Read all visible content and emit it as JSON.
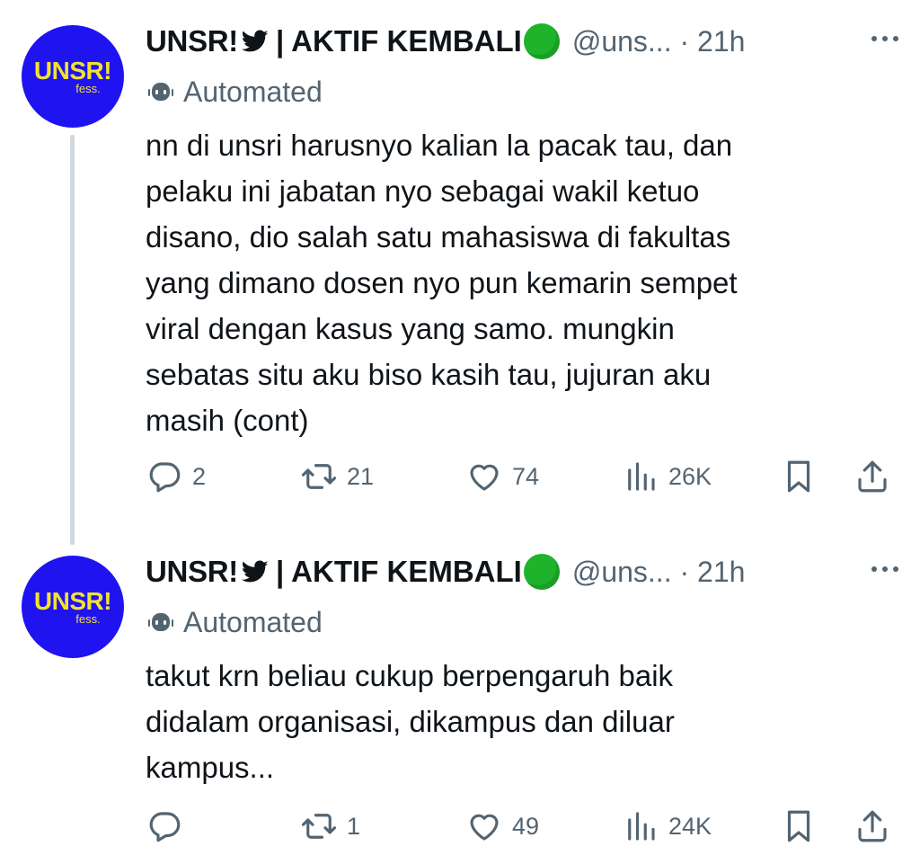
{
  "tweets": [
    {
      "avatar": {
        "main": "UNSR!",
        "sub": "fess."
      },
      "name": "UNSR!",
      "name_rest": "| AKTIF KEMBALI",
      "handle": "@uns... · 21h",
      "label": "Automated",
      "text_lines": [
        "nn di unsri harusnyo kalian la pacak tau, dan",
        "pelaku ini jabatan nyo sebagai wakil ketuo",
        "disano, dio salah satu mahasiswa di fakultas",
        "yang dimano dosen nyo pun kemarin sempet",
        "viral dengan kasus yang samo. mungkin",
        "sebatas situ aku biso kasih tau, jujuran aku",
        "masih (cont)"
      ],
      "replies": "2",
      "reposts": "21",
      "likes": "74",
      "views": "26K"
    },
    {
      "avatar": {
        "main": "UNSR!",
        "sub": "fess."
      },
      "name": "UNSR!",
      "name_rest": "| AKTIF KEMBALI",
      "handle": "@uns... · 21h",
      "label": "Automated",
      "text_lines": [
        "takut krn beliau cukup berpengaruh baik",
        "didalam organisasi, dikampus dan diluar",
        "kampus..."
      ],
      "replies": "",
      "reposts": "1",
      "likes": "49",
      "views": "24K"
    }
  ],
  "icons": [
    "bird-icon",
    "green-circle-icon",
    "robot-icon",
    "more-icon",
    "reply-icon",
    "repost-icon",
    "like-icon",
    "views-icon",
    "bookmark-icon",
    "share-icon"
  ],
  "colors": {
    "avatar_bg": "#1f13f0",
    "avatar_text": "#f2e230",
    "muted": "#536471",
    "text": "#0f1419",
    "thread_line": "#cfd9de",
    "status_dot": "#1fb32c"
  }
}
